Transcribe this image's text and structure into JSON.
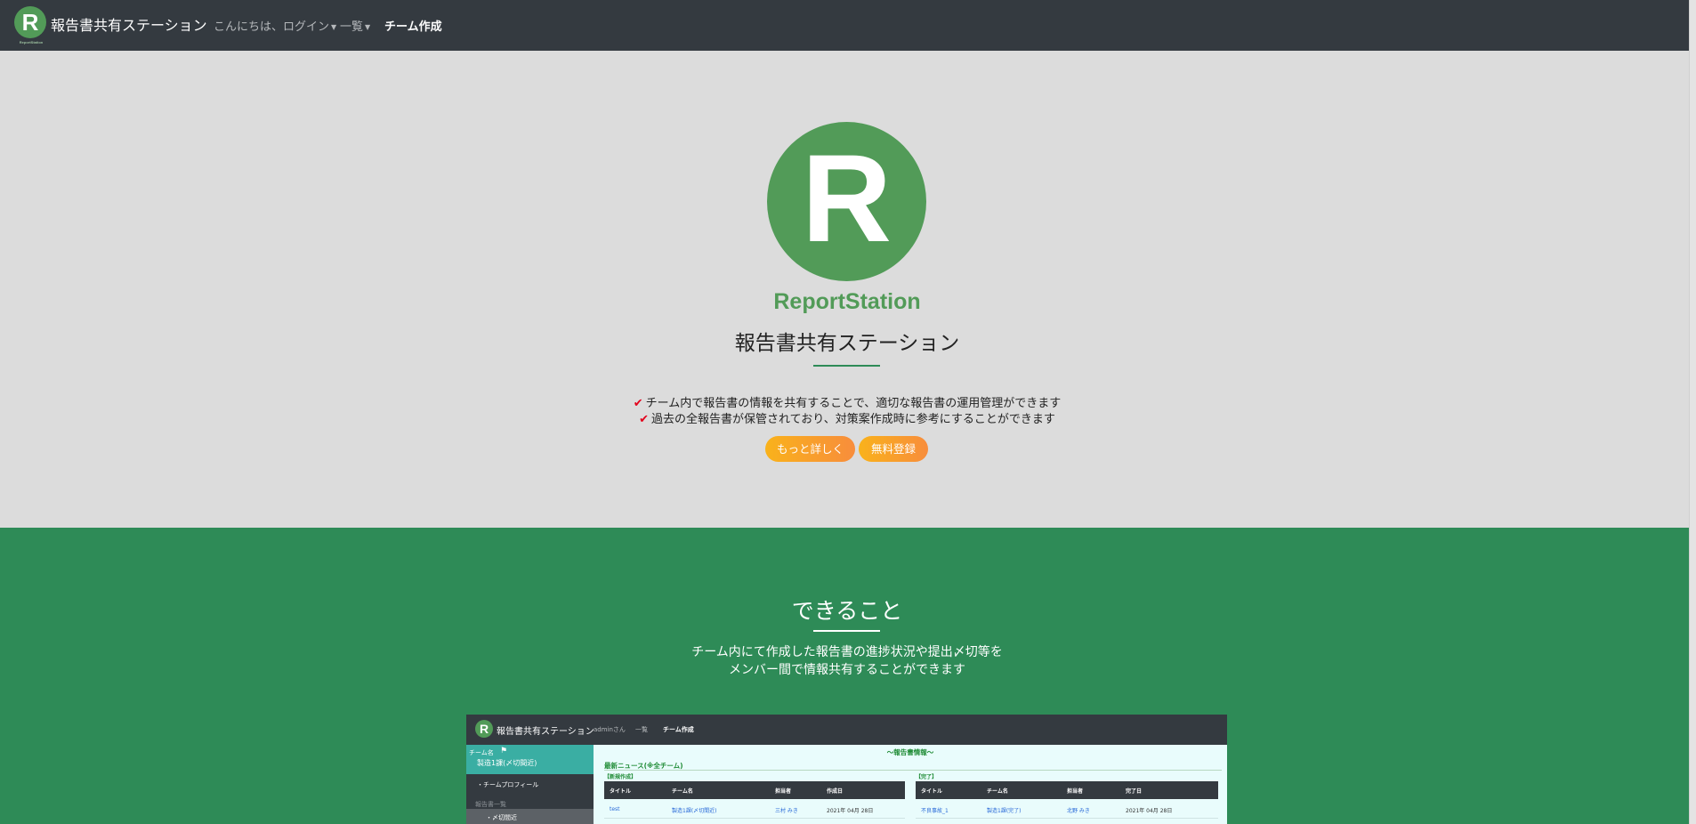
{
  "navbar": {
    "logo_letter": "R",
    "logo_caption": "ReportStation",
    "brand": "報告書共有ステーション",
    "greeting": "こんにちは、ログイン",
    "list_menu": "一覧",
    "team_create": "チーム作成"
  },
  "hero": {
    "logo_letter": "R",
    "logo_text": "ReportStation",
    "title": "報告書共有ステーション",
    "features": [
      "チーム内で報告書の情報を共有することで、適切な報告書の運用管理ができます",
      "過去の全報告書が保管されており、対策案作成時に参考にすることができます"
    ],
    "more_button": "もっと詳しく",
    "register_button": "無料登録"
  },
  "section2": {
    "title": "できること",
    "desc_line1": "チーム内にて作成した報告書の進捗状況や提出〆切等を",
    "desc_line2": "メンバー間で情報共有することができます"
  },
  "screenshot": {
    "logo_letter": "R",
    "brand": "報告書共有ステーション",
    "nav_user": "adminさん",
    "nav_list": "一覧",
    "nav_team_create": "チーム作成",
    "side_team_label": "チーム名",
    "side_team_name": "製造1課(〆切間近)",
    "side_profile": "・チームプロフィール",
    "side_report_list": "報告書一覧",
    "side_deadline": "・〆切間近",
    "main_heading": "〜報告書情報〜",
    "news_heading": "最新ニュース(※全チーム)",
    "left_label": "【新規作成】",
    "right_label": "【完了】",
    "left_headers": [
      "タイトル",
      "チーム名",
      "担当者",
      "作成日"
    ],
    "right_headers": [
      "タイトル",
      "チーム名",
      "担当者",
      "完了日"
    ],
    "left_row": [
      "test",
      "製造1課(〆切間近)",
      "三村 みき",
      "2021年 04月 28日"
    ],
    "right_row": [
      "不良事故_1",
      "製造1課(完了)",
      "北野 みき",
      "2021年 04月 28日"
    ]
  },
  "colors": {
    "navbar": "#343a40",
    "brand_green": "#529b58",
    "section_green": "#2e8b57",
    "button_gradient_start": "#f9b21b",
    "button_gradient_end": "#f88d3c",
    "check_red": "#e3001b"
  }
}
